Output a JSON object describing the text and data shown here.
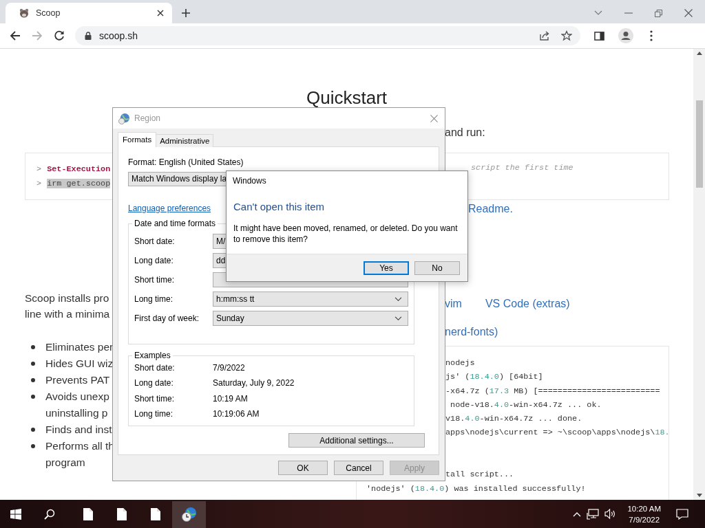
{
  "browser": {
    "tab_title": "Scoop",
    "forward_enabled": false,
    "address": "scoop.sh"
  },
  "page": {
    "heading": "Quickstart",
    "left": {
      "commands": [
        {
          "prompt": ">",
          "text": "Set-Execution",
          "kind": "keyword",
          "selected": false
        },
        {
          "prompt": ">",
          "text": "irm get.scoop",
          "kind": "plain",
          "selected": true
        }
      ],
      "intro": [
        "Scoop installs pro",
        "line with a minima"
      ],
      "bullets": [
        [
          "Eliminates per"
        ],
        [
          "Hides GUI wiz"
        ],
        [
          "Prevents PAT"
        ],
        [
          "Avoids unexp",
          "uninstalling p"
        ],
        [
          "Finds and inst"
        ],
        [
          "Performs all th",
          "program"
        ]
      ]
    },
    "right": {
      "instruction": "and run:",
      "comment": "script the first time",
      "readme_link": "Readme.",
      "editor_links": [
        "vim",
        "VS Code (extras)"
      ],
      "font_link": "nerd-fonts)",
      "output_lines": [
        {
          "kind": "covered",
          "segments": [
            {
              "kind": "text",
              "text": "nodejs"
            }
          ]
        },
        {
          "kind": "covered",
          "segments": [
            {
              "kind": "text",
              "text": "js' ("
            },
            {
              "kind": "num",
              "text": "18.4.0"
            },
            {
              "kind": "text",
              "text": ") [64bit]"
            }
          ]
        },
        {
          "kind": "covered",
          "segments": [
            {
              "kind": "text",
              "text": "-x64.7z ("
            },
            {
              "kind": "num",
              "text": "17.3"
            },
            {
              "kind": "text",
              "text": " MB) [========================="
            }
          ]
        },
        {
          "kind": "covered",
          "segments": [
            {
              "kind": "text",
              "text": " node-v18."
            },
            {
              "kind": "num",
              "text": "4.0"
            },
            {
              "kind": "text",
              "text": "-win-x64.7z ... ok."
            }
          ]
        },
        {
          "kind": "covered",
          "segments": [
            {
              "kind": "text",
              "text": "v18."
            },
            {
              "kind": "num",
              "text": "4.0"
            },
            {
              "kind": "text",
              "text": "-win-x64.7z ... done."
            }
          ]
        },
        {
          "kind": "covered",
          "segments": [
            {
              "kind": "text",
              "text": "apps\\nodejs\\current => ~\\scoop\\apps\\nodejs\\"
            },
            {
              "kind": "num",
              "text": "18."
            }
          ]
        },
        {
          "kind": "covered_gap",
          "segments": [
            {
              "kind": "text",
              "text": "tall script..."
            }
          ]
        },
        {
          "kind": "full",
          "segments": [
            {
              "kind": "text",
              "text": "'nodejs' ("
            },
            {
              "kind": "num",
              "text": "18.4.0"
            },
            {
              "kind": "text",
              "text": ") was installed successfully!"
            }
          ]
        }
      ]
    }
  },
  "region_dialog": {
    "title": "Region",
    "tabs": [
      {
        "label": "Formats",
        "selected": true
      },
      {
        "label": "Administrative",
        "selected": false
      }
    ],
    "format_label": "Format: English (United States)",
    "format_value": "Match Windows display la",
    "language_link": "Language preferences",
    "formats_group": {
      "title": "Date and time formats",
      "rows": [
        {
          "label": "Short date:",
          "value": "M/"
        },
        {
          "label": "Long date:",
          "value": "dd"
        },
        {
          "label": "Short time:"
        },
        {
          "label": "Long time:",
          "value": "h:mm:ss tt",
          "arrow": true
        },
        {
          "label": "First day of week:",
          "value": "Sunday",
          "arrow": true
        }
      ]
    },
    "examples_group": {
      "title": "Examples",
      "rows": [
        {
          "label": "Short date:",
          "value": "7/9/2022"
        },
        {
          "label": "Long date:",
          "value": "Saturday, July 9, 2022"
        },
        {
          "label": "Short time:",
          "value": "10:19 AM"
        },
        {
          "label": "Long time:",
          "value": "10:19:06 AM"
        }
      ]
    },
    "additional_button": "Additional settings...",
    "buttons": [
      {
        "label": "OK",
        "disabled": false
      },
      {
        "label": "Cancel",
        "disabled": false
      },
      {
        "label": "Apply",
        "disabled": true
      }
    ]
  },
  "message_dialog": {
    "title": "Windows",
    "heading": "Can't open this item",
    "message": "It might have been moved, renamed, or deleted. Do you want to remove this item?",
    "buttons": [
      {
        "label": "Yes",
        "default": true
      },
      {
        "label": "No",
        "default": false
      }
    ]
  },
  "taskbar": {
    "apps": [
      {
        "kind": "file",
        "running": true,
        "selected": false
      },
      {
        "kind": "file",
        "running": true,
        "selected": false
      },
      {
        "kind": "file",
        "running": true,
        "selected": false
      },
      {
        "kind": "globe-clock",
        "running": true,
        "selected": true
      }
    ],
    "time": "10:20 AM",
    "date": "7/9/2022"
  }
}
